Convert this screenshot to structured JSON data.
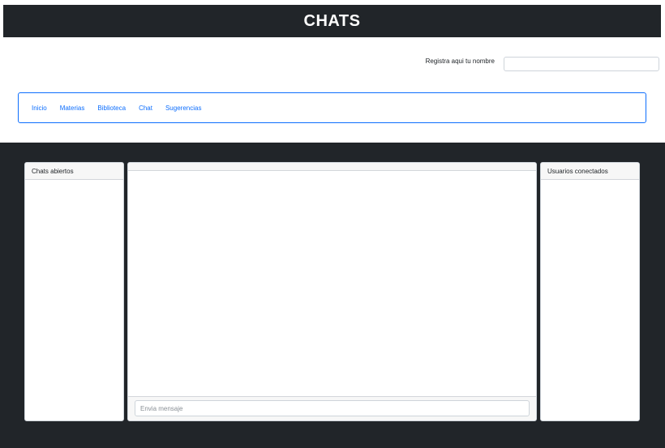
{
  "header": {
    "title": "CHATS"
  },
  "register": {
    "label": "Registra aqui tu nombre",
    "value": "",
    "placeholder": ""
  },
  "nav": {
    "items": [
      {
        "label": "Inicio"
      },
      {
        "label": "Materias"
      },
      {
        "label": "Biblioteca"
      },
      {
        "label": "Chat"
      },
      {
        "label": "Sugerencias"
      }
    ]
  },
  "chat": {
    "open_chats_title": "Chats abiertos",
    "connected_users_title": "Usuarios conectados",
    "message_placeholder": "Envia mensaje"
  },
  "colors": {
    "header_bg": "#212529",
    "nav_link": "#0d6efd",
    "dark_area": "#212529"
  }
}
